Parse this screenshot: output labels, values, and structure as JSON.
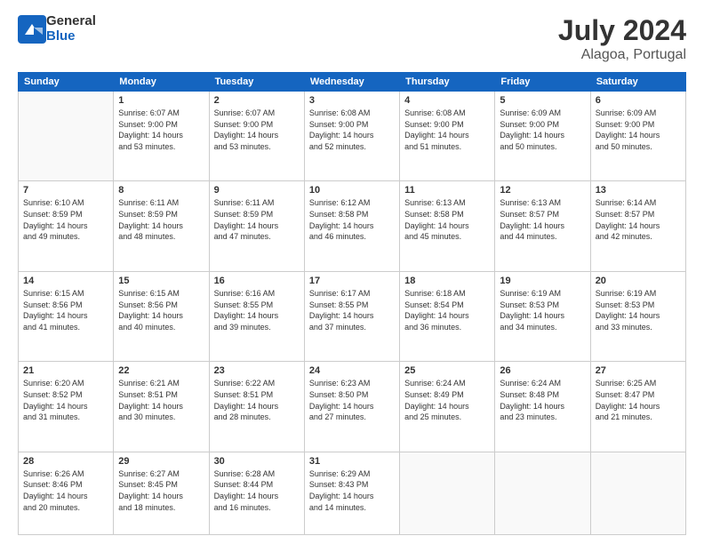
{
  "header": {
    "logo_line1": "General",
    "logo_line2": "Blue",
    "month_year": "July 2024",
    "location": "Alagoa, Portugal"
  },
  "weekdays": [
    "Sunday",
    "Monday",
    "Tuesday",
    "Wednesday",
    "Thursday",
    "Friday",
    "Saturday"
  ],
  "weeks": [
    [
      {
        "day": "",
        "sunrise": "",
        "sunset": "",
        "daylight": ""
      },
      {
        "day": "1",
        "sunrise": "Sunrise: 6:07 AM",
        "sunset": "Sunset: 9:00 PM",
        "daylight": "Daylight: 14 hours and 53 minutes."
      },
      {
        "day": "2",
        "sunrise": "Sunrise: 6:07 AM",
        "sunset": "Sunset: 9:00 PM",
        "daylight": "Daylight: 14 hours and 53 minutes."
      },
      {
        "day": "3",
        "sunrise": "Sunrise: 6:08 AM",
        "sunset": "Sunset: 9:00 PM",
        "daylight": "Daylight: 14 hours and 52 minutes."
      },
      {
        "day": "4",
        "sunrise": "Sunrise: 6:08 AM",
        "sunset": "Sunset: 9:00 PM",
        "daylight": "Daylight: 14 hours and 51 minutes."
      },
      {
        "day": "5",
        "sunrise": "Sunrise: 6:09 AM",
        "sunset": "Sunset: 9:00 PM",
        "daylight": "Daylight: 14 hours and 50 minutes."
      },
      {
        "day": "6",
        "sunrise": "Sunrise: 6:09 AM",
        "sunset": "Sunset: 9:00 PM",
        "daylight": "Daylight: 14 hours and 50 minutes."
      }
    ],
    [
      {
        "day": "7",
        "sunrise": "Sunrise: 6:10 AM",
        "sunset": "Sunset: 8:59 PM",
        "daylight": "Daylight: 14 hours and 49 minutes."
      },
      {
        "day": "8",
        "sunrise": "Sunrise: 6:11 AM",
        "sunset": "Sunset: 8:59 PM",
        "daylight": "Daylight: 14 hours and 48 minutes."
      },
      {
        "day": "9",
        "sunrise": "Sunrise: 6:11 AM",
        "sunset": "Sunset: 8:59 PM",
        "daylight": "Daylight: 14 hours and 47 minutes."
      },
      {
        "day": "10",
        "sunrise": "Sunrise: 6:12 AM",
        "sunset": "Sunset: 8:58 PM",
        "daylight": "Daylight: 14 hours and 46 minutes."
      },
      {
        "day": "11",
        "sunrise": "Sunrise: 6:13 AM",
        "sunset": "Sunset: 8:58 PM",
        "daylight": "Daylight: 14 hours and 45 minutes."
      },
      {
        "day": "12",
        "sunrise": "Sunrise: 6:13 AM",
        "sunset": "Sunset: 8:57 PM",
        "daylight": "Daylight: 14 hours and 44 minutes."
      },
      {
        "day": "13",
        "sunrise": "Sunrise: 6:14 AM",
        "sunset": "Sunset: 8:57 PM",
        "daylight": "Daylight: 14 hours and 42 minutes."
      }
    ],
    [
      {
        "day": "14",
        "sunrise": "Sunrise: 6:15 AM",
        "sunset": "Sunset: 8:56 PM",
        "daylight": "Daylight: 14 hours and 41 minutes."
      },
      {
        "day": "15",
        "sunrise": "Sunrise: 6:15 AM",
        "sunset": "Sunset: 8:56 PM",
        "daylight": "Daylight: 14 hours and 40 minutes."
      },
      {
        "day": "16",
        "sunrise": "Sunrise: 6:16 AM",
        "sunset": "Sunset: 8:55 PM",
        "daylight": "Daylight: 14 hours and 39 minutes."
      },
      {
        "day": "17",
        "sunrise": "Sunrise: 6:17 AM",
        "sunset": "Sunset: 8:55 PM",
        "daylight": "Daylight: 14 hours and 37 minutes."
      },
      {
        "day": "18",
        "sunrise": "Sunrise: 6:18 AM",
        "sunset": "Sunset: 8:54 PM",
        "daylight": "Daylight: 14 hours and 36 minutes."
      },
      {
        "day": "19",
        "sunrise": "Sunrise: 6:19 AM",
        "sunset": "Sunset: 8:53 PM",
        "daylight": "Daylight: 14 hours and 34 minutes."
      },
      {
        "day": "20",
        "sunrise": "Sunrise: 6:19 AM",
        "sunset": "Sunset: 8:53 PM",
        "daylight": "Daylight: 14 hours and 33 minutes."
      }
    ],
    [
      {
        "day": "21",
        "sunrise": "Sunrise: 6:20 AM",
        "sunset": "Sunset: 8:52 PM",
        "daylight": "Daylight: 14 hours and 31 minutes."
      },
      {
        "day": "22",
        "sunrise": "Sunrise: 6:21 AM",
        "sunset": "Sunset: 8:51 PM",
        "daylight": "Daylight: 14 hours and 30 minutes."
      },
      {
        "day": "23",
        "sunrise": "Sunrise: 6:22 AM",
        "sunset": "Sunset: 8:51 PM",
        "daylight": "Daylight: 14 hours and 28 minutes."
      },
      {
        "day": "24",
        "sunrise": "Sunrise: 6:23 AM",
        "sunset": "Sunset: 8:50 PM",
        "daylight": "Daylight: 14 hours and 27 minutes."
      },
      {
        "day": "25",
        "sunrise": "Sunrise: 6:24 AM",
        "sunset": "Sunset: 8:49 PM",
        "daylight": "Daylight: 14 hours and 25 minutes."
      },
      {
        "day": "26",
        "sunrise": "Sunrise: 6:24 AM",
        "sunset": "Sunset: 8:48 PM",
        "daylight": "Daylight: 14 hours and 23 minutes."
      },
      {
        "day": "27",
        "sunrise": "Sunrise: 6:25 AM",
        "sunset": "Sunset: 8:47 PM",
        "daylight": "Daylight: 14 hours and 21 minutes."
      }
    ],
    [
      {
        "day": "28",
        "sunrise": "Sunrise: 6:26 AM",
        "sunset": "Sunset: 8:46 PM",
        "daylight": "Daylight: 14 hours and 20 minutes."
      },
      {
        "day": "29",
        "sunrise": "Sunrise: 6:27 AM",
        "sunset": "Sunset: 8:45 PM",
        "daylight": "Daylight: 14 hours and 18 minutes."
      },
      {
        "day": "30",
        "sunrise": "Sunrise: 6:28 AM",
        "sunset": "Sunset: 8:44 PM",
        "daylight": "Daylight: 14 hours and 16 minutes."
      },
      {
        "day": "31",
        "sunrise": "Sunrise: 6:29 AM",
        "sunset": "Sunset: 8:43 PM",
        "daylight": "Daylight: 14 hours and 14 minutes."
      },
      {
        "day": "",
        "sunrise": "",
        "sunset": "",
        "daylight": ""
      },
      {
        "day": "",
        "sunrise": "",
        "sunset": "",
        "daylight": ""
      },
      {
        "day": "",
        "sunrise": "",
        "sunset": "",
        "daylight": ""
      }
    ]
  ]
}
